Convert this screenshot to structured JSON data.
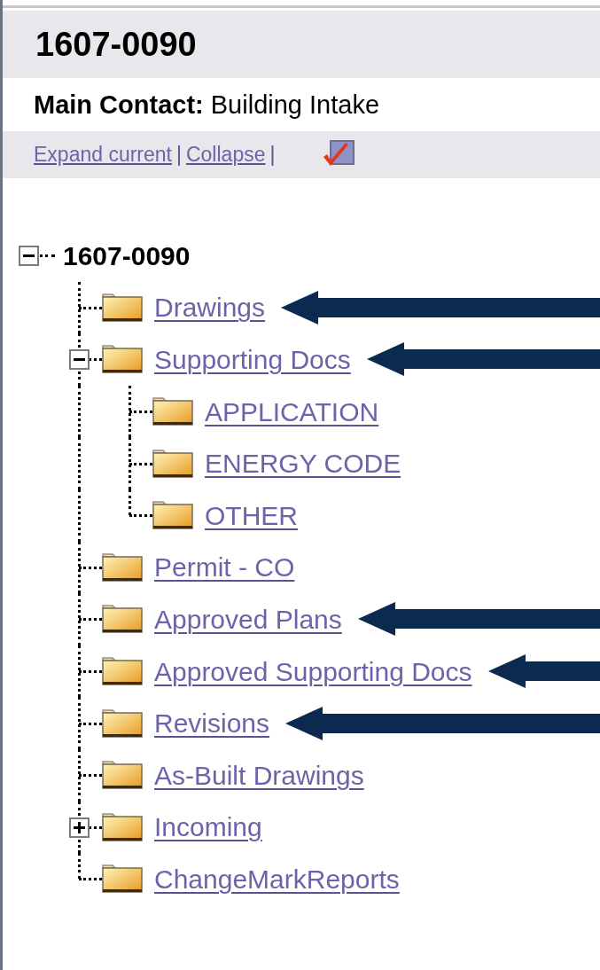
{
  "header": {
    "title": "1607-0090"
  },
  "contact": "**Main Contact:** Building Intake",
  "toolbar": [
    {
      "kind": "link",
      "text": "Expand current"
    },
    {
      "kind": "separator",
      "text": "|"
    },
    {
      "kind": "link",
      "text": "Collapse"
    },
    {
      "kind": "separator",
      "text": "|"
    },
    {
      "kind": "check_icon"
    }
  ],
  "tree": {
    "label": "1607-0090",
    "expanded": true,
    "children": [
      {
        "label": "Drawings",
        "marked": true
      },
      {
        "label": "Supporting Docs",
        "marked": true,
        "expanded": true,
        "children": [
          {
            "label": "APPLICATION",
            "marked": false
          },
          {
            "label": "ENERGY CODE",
            "marked": false
          },
          {
            "label": "OTHER",
            "marked": false
          }
        ]
      },
      {
        "label": "Permit - CO",
        "marked": false
      },
      {
        "label": "Approved Plans",
        "marked": true
      },
      {
        "label": "Approved Supporting Docs",
        "marked": true
      },
      {
        "label": "Revisions",
        "marked": true
      },
      {
        "label": "As-Built Drawings",
        "marked": false
      },
      {
        "label": "Incoming",
        "marked": false,
        "expanded": false
      },
      {
        "label": "ChangeMarkReports",
        "marked": false
      }
    ]
  }
}
